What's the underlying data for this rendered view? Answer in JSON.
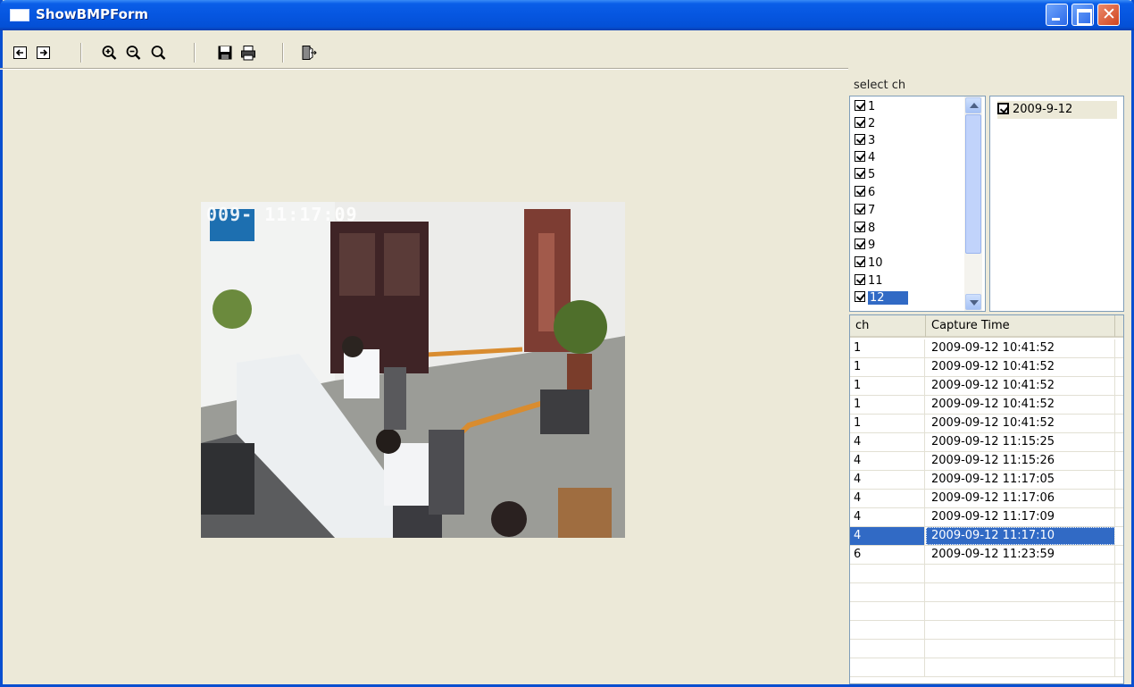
{
  "window": {
    "title": "ShowBMPForm"
  },
  "toolbar": {
    "icons": [
      "prev-icon",
      "next-icon",
      "zoom-in-icon",
      "zoom-out-icon",
      "zoom-fit-icon",
      "save-icon",
      "print-icon",
      "exit-icon"
    ]
  },
  "photo": {
    "overlay_text": "009-  11:17:09"
  },
  "select_ch": {
    "label": "select ch",
    "channels": [
      "1",
      "2",
      "3",
      "4",
      "5",
      "6",
      "7",
      "8",
      "9",
      "10",
      "11",
      "12"
    ],
    "selected": "12"
  },
  "dates": {
    "items": [
      "2009-9-12"
    ]
  },
  "grid": {
    "columns": [
      "ch",
      "Capture Time"
    ],
    "rows": [
      {
        "ch": "1",
        "time": "2009-09-12 10:41:52"
      },
      {
        "ch": "1",
        "time": "2009-09-12 10:41:52"
      },
      {
        "ch": "1",
        "time": "2009-09-12 10:41:52"
      },
      {
        "ch": "1",
        "time": "2009-09-12 10:41:52"
      },
      {
        "ch": "1",
        "time": "2009-09-12 10:41:52"
      },
      {
        "ch": "4",
        "time": "2009-09-12 11:15:25"
      },
      {
        "ch": "4",
        "time": "2009-09-12 11:15:26"
      },
      {
        "ch": "4",
        "time": "2009-09-12 11:17:05"
      },
      {
        "ch": "4",
        "time": "2009-09-12 11:17:06"
      },
      {
        "ch": "4",
        "time": "2009-09-12 11:17:09"
      },
      {
        "ch": "4",
        "time": "2009-09-12 11:17:10"
      },
      {
        "ch": "6",
        "time": "2009-09-12 11:23:59"
      }
    ],
    "selected_row": 10
  },
  "colors": {
    "titlebar": "#0656e0",
    "selection": "#316ac5",
    "face": "#ece9d8"
  }
}
